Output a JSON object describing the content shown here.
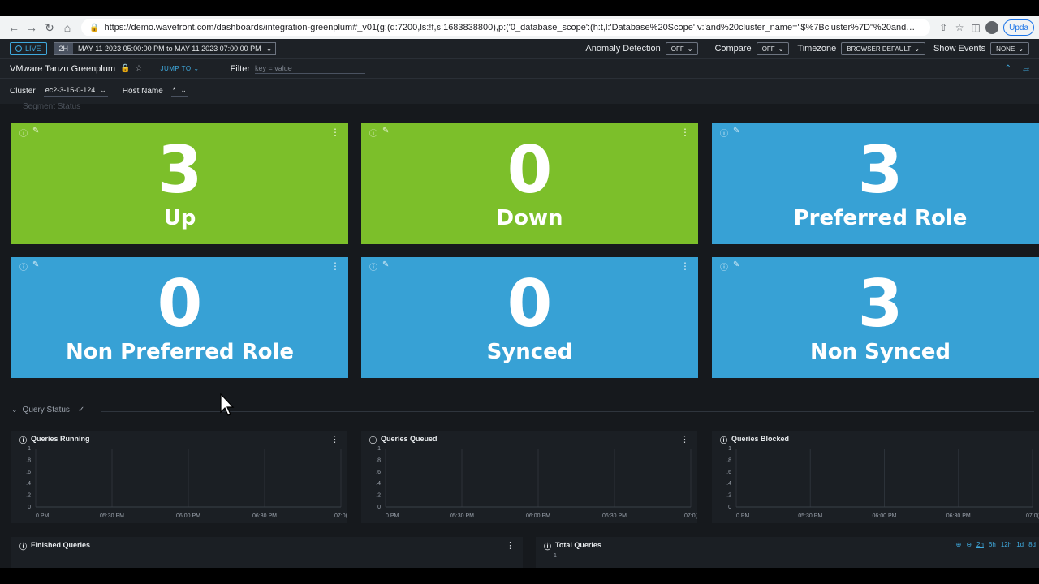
{
  "browser": {
    "url": "https://demo.wavefront.com/dashboards/integration-greenplum#_v01(g:(d:7200,ls:!f,s:1683838800),p:('0_database_scope':(h:t,l:'Database%20Scope',v:'and%20cluster_name=\"$%7Bcluster%7D\"%20and%20source=\"$%7B1...",
    "update_label": "Upda"
  },
  "timebar": {
    "live_label": "LIVE",
    "range_short": "2H",
    "range_text": "MAY 11 2023 05:00:00 PM  to  MAY 11 2023 07:00:00 PM",
    "anomaly_label": "Anomaly Detection",
    "anomaly_value": "OFF",
    "compare_label": "Compare",
    "compare_value": "OFF",
    "timezone_label": "Timezone",
    "timezone_value": "BROWSER DEFAULT",
    "events_label": "Show Events",
    "events_value": "NONE"
  },
  "titlebar": {
    "title": "VMware Tanzu Greenplum",
    "jump_to": "JUMP TO",
    "filter_label": "Filter",
    "filter_placeholder": "key = value"
  },
  "variables": {
    "cluster_label": "Cluster",
    "cluster_value": "ec2-3-15-0-124",
    "host_label": "Host Name",
    "host_value": "*"
  },
  "section_ghost": "Segment Status",
  "tiles": [
    {
      "value": "3",
      "label": "Up"
    },
    {
      "value": "0",
      "label": "Down"
    },
    {
      "value": "3",
      "label": "Preferred Role"
    },
    {
      "value": "0",
      "label": "Non Preferred Role"
    },
    {
      "value": "0",
      "label": "Synced"
    },
    {
      "value": "3",
      "label": "Non Synced"
    }
  ],
  "colors": {
    "green": "#7cbf2a",
    "blue": "#37a1d5",
    "accent": "#3fa9dd"
  },
  "query_status": {
    "label": "Query Status"
  },
  "charts": [
    {
      "title": "Queries Running",
      "y_ticks": [
        "1",
        ".8",
        ".6",
        ".4",
        ".2",
        "0"
      ],
      "x_ticks": [
        "0 PM",
        "05:30 PM",
        "06:00 PM",
        "06:30 PM",
        "07:0("
      ]
    },
    {
      "title": "Queries Queued",
      "y_ticks": [
        "1",
        ".8",
        ".6",
        ".4",
        ".2",
        "0"
      ],
      "x_ticks": [
        "0 PM",
        "05:30 PM",
        "06:00 PM",
        "06:30 PM",
        "07:0("
      ]
    },
    {
      "title": "Queries Blocked",
      "y_ticks": [
        "1",
        ".8",
        ".6",
        ".4",
        ".2",
        "0"
      ],
      "x_ticks": [
        "0 PM",
        "05:30 PM",
        "06:00 PM",
        "06:30 PM",
        "07:0("
      ]
    }
  ],
  "bottom": {
    "finished_title": "Finished Queries",
    "total_title": "Total Queries",
    "total_y_tick": "1",
    "ranges": [
      "2h",
      "6h",
      "12h",
      "1d",
      "8d"
    ]
  }
}
